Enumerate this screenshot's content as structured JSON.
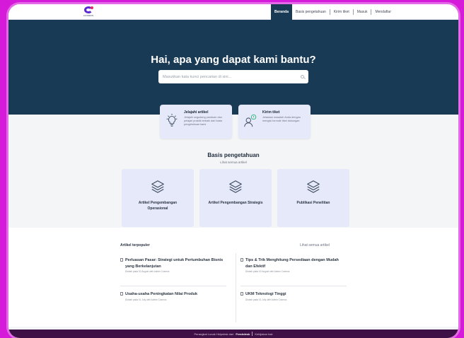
{
  "header": {
    "logo_text": "COSMOS",
    "nav": [
      {
        "label": "Beranda",
        "active": true
      },
      {
        "label": "Basis pengetahuan",
        "active": false
      },
      {
        "label": "Kirim tiket",
        "active": false
      },
      {
        "label": "Masuk",
        "active": false
      },
      {
        "label": "Mendaftar",
        "active": false
      }
    ]
  },
  "hero": {
    "title": "Hai, apa yang dapat kami bantu?",
    "search_placeholder": "Masukkan kata kunci pencarian di sini..."
  },
  "quick_cards": [
    {
      "title": "Jelajahi artikel",
      "desc": "Jelajahi segudang panduan dan pelajari praktik terbaik dari basis pengetahuan kami",
      "icon": "lightbulb-icon"
    },
    {
      "title": "Kirim tiket",
      "desc": "Jelaskan masalah Anda dengan mengisi formulir tiket dukungan",
      "icon": "person-support-icon"
    }
  ],
  "knowledge_base": {
    "title": "Basis pengetahuan",
    "link": "Lihat semua artikel",
    "cards": [
      {
        "label": "Artikel Pengembangan Operasional",
        "icon": "layers-icon"
      },
      {
        "label": "Artikel Pengembangan Strategis",
        "icon": "layers-icon"
      },
      {
        "label": "Publikasi Penelitian",
        "icon": "layers-icon"
      }
    ]
  },
  "popular": {
    "title": "Artikel terpopuler",
    "see_all": "Lihat semua artikel",
    "articles": [
      {
        "title": "Perluasan Pasar: Strategi untuk Pertumbuhan Bisnis yang Berkelanjutan",
        "meta": "Diubah pada 02 August oleh Admin Cosmos"
      },
      {
        "title": "Tips & Trik Menghitung Persediaan dengan Mudah dan Efektif",
        "meta": "Diubah pada 02 August oleh Admin Cosmos"
      },
      {
        "title": "Usaha-usaha Peningkatan Nilai Produk",
        "meta": "Diubah pada 01 July oleh Admin Cosmos"
      },
      {
        "title": "UKM Teknologi Tinggi",
        "meta": "Diubah pada 01 July oleh Admin Cosmos"
      }
    ]
  },
  "footer": {
    "prefix": "Perangkat Lunak Helpdesk dari",
    "brand": "Freshdesk",
    "privacy": "Kebijakan hak"
  },
  "colors": {
    "background": "#d61ad9",
    "hero": "#193a55",
    "card": "#e6e9f9",
    "footer": "#3f1045"
  }
}
